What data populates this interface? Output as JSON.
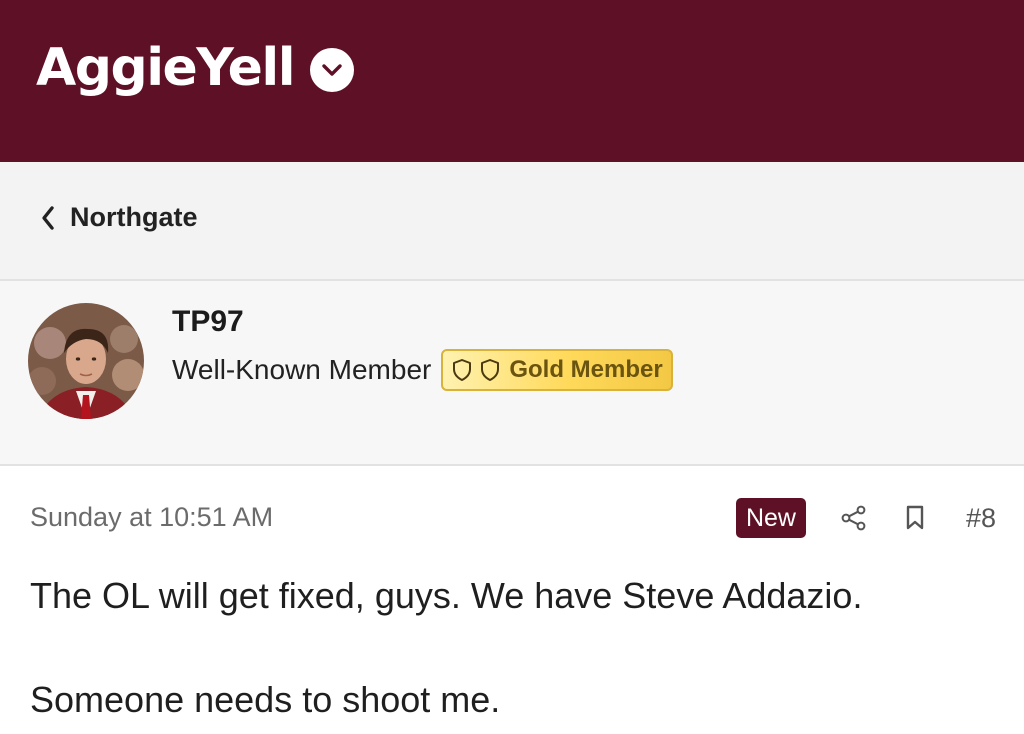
{
  "site": {
    "name": "AggieYell",
    "brand_color": "#5e1126",
    "menu_icon": "chevron-down-icon"
  },
  "breadcrumb": {
    "label": "Northgate",
    "icon": "chevron-left-icon"
  },
  "author": {
    "username": "TP97",
    "title": "Well-Known Member",
    "badge": {
      "label": "Gold Member",
      "icons": [
        "shield-icon",
        "shield-icon"
      ],
      "color": "#ffd95a"
    },
    "avatar": "avatar-photo"
  },
  "post": {
    "date": "Sunday at 10:51 AM",
    "new_label": "New",
    "share_icon": "share-icon",
    "bookmark_icon": "bookmark-icon",
    "number": "#8",
    "paragraphs": [
      "The OL will get fixed, guys. We have Steve Addazio.",
      "Someone needs to shoot me."
    ]
  }
}
